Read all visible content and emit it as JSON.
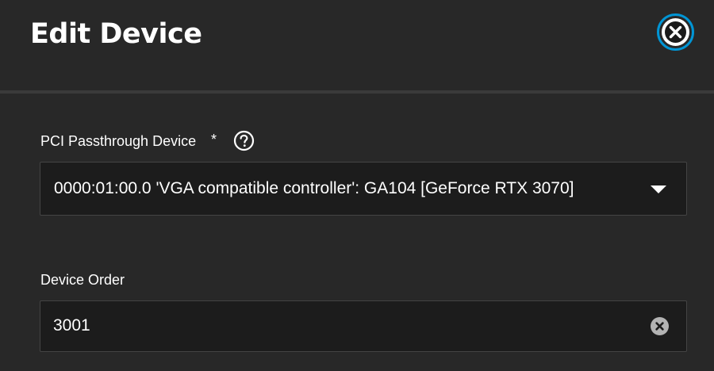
{
  "dialog": {
    "title": "Edit Device",
    "close_icon": "close-icon"
  },
  "form": {
    "pci_device": {
      "label": "PCI Passthrough Device",
      "required_marker": "*",
      "help_icon": "help-circle-icon",
      "selected_value": "0000:01:00.0 'VGA compatible controller': GA104 [GeForce RTX 3070]",
      "dropdown_icon": "caret-down-icon"
    },
    "device_order": {
      "label": "Device Order",
      "value": "3001",
      "clear_icon": "clear-circle-icon"
    }
  },
  "colors": {
    "background": "#282828",
    "field_background": "#1c1c1c",
    "accent": "#0095d5",
    "text": "#ffffff"
  }
}
